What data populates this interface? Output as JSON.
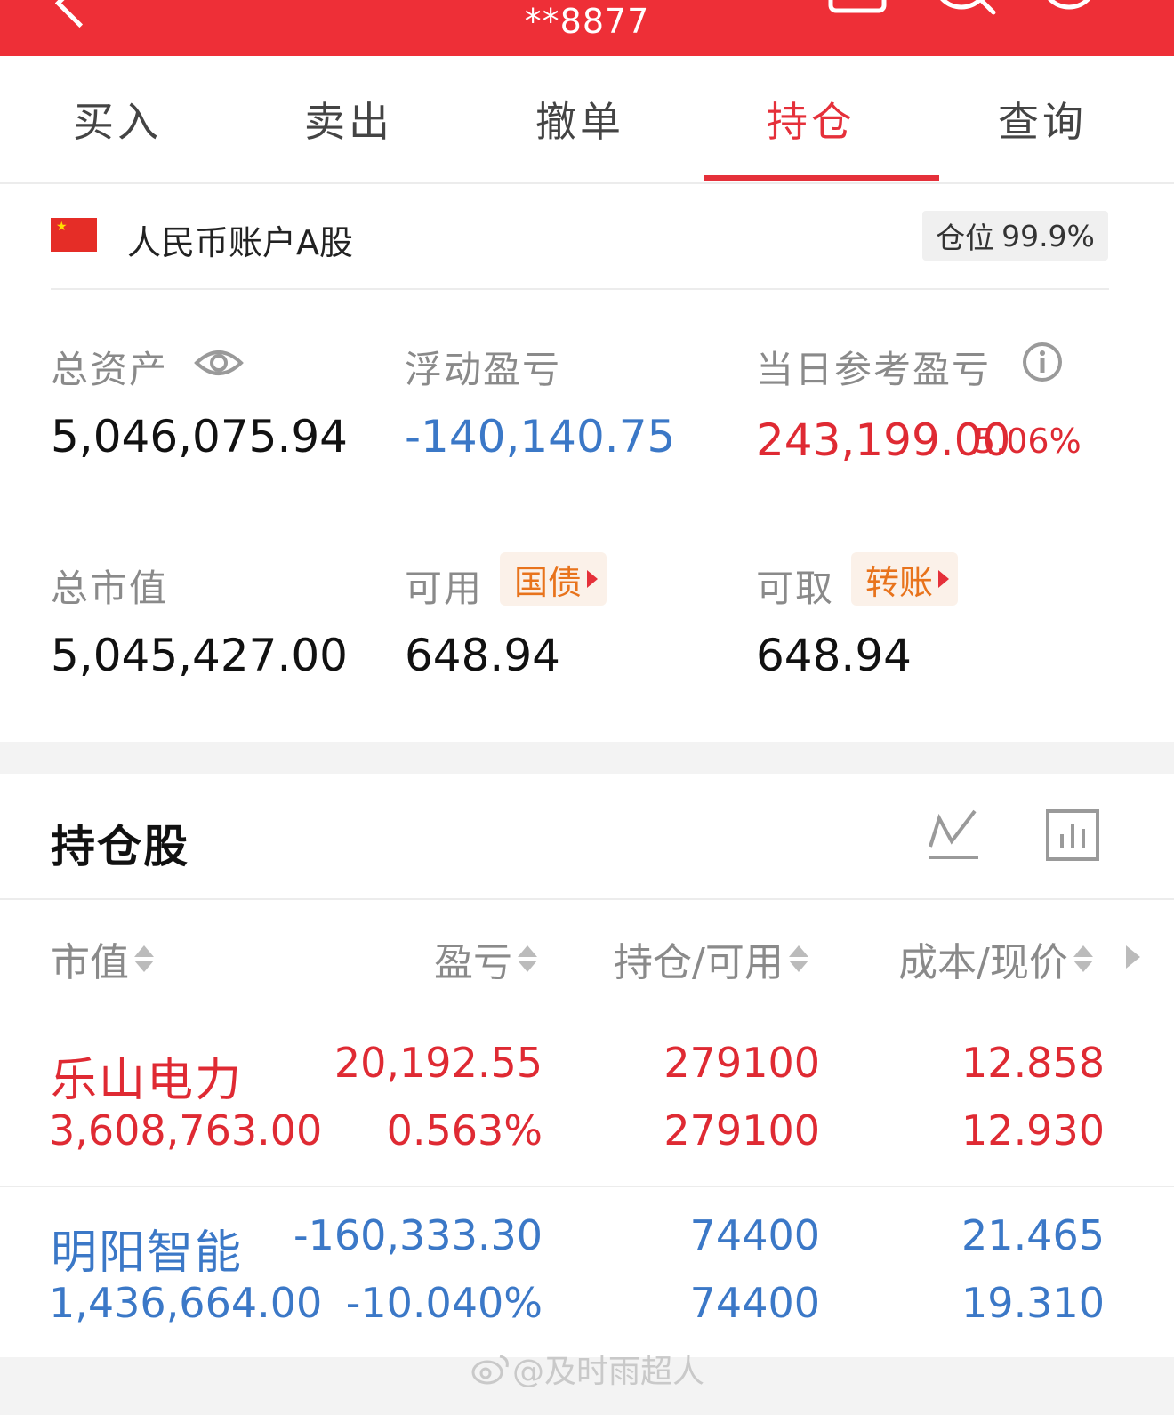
{
  "header": {
    "title": "**8877",
    "background_color": "#ee2f37",
    "icons": [
      "back-icon",
      "clipboard-icon",
      "search-icon",
      "service-icon"
    ]
  },
  "tabs": [
    {
      "label": "买入",
      "active": false
    },
    {
      "label": "卖出",
      "active": false
    },
    {
      "label": "撤单",
      "active": false
    },
    {
      "label": "持仓",
      "active": true
    },
    {
      "label": "查询",
      "active": false
    }
  ],
  "account": {
    "flag_icon": "china-flag-icon",
    "name": "人民币账户A股",
    "position_label": "仓位",
    "position_value": "99.9%"
  },
  "summary": {
    "total_assets_label": "总资产",
    "total_assets_value": "5,046,075.94",
    "floating_pl_label": "浮动盈亏",
    "floating_pl_value": "-140,140.75",
    "daily_pl_label": "当日参考盈亏",
    "daily_pl_value": "243,199.00",
    "daily_pl_pct": "5.06%",
    "market_value_label": "总市值",
    "market_value_value": "5,045,427.00",
    "available_label": "可用",
    "available_badge": "国债",
    "available_value": "648.94",
    "withdrawable_label": "可取",
    "withdrawable_badge": "转账",
    "withdrawable_value": "648.94"
  },
  "holdings": {
    "title": "持仓股",
    "columns": [
      "市值",
      "盈亏",
      "持仓/可用",
      "成本/现价"
    ],
    "rows": [
      {
        "name": "乐山电力",
        "market_value": "3,608,763.00",
        "pl": "20,192.55",
        "pl_pct": "0.563%",
        "position": "279100",
        "available": "279100",
        "cost": "12.858",
        "price": "12.930",
        "color": "#df2a33"
      },
      {
        "name": "明阳智能",
        "market_value": "1,436,664.00",
        "pl": "-160,333.30",
        "pl_pct": "-10.040%",
        "position": "74400",
        "available": "74400",
        "cost": "21.465",
        "price": "19.310",
        "color": "#3b78c7"
      }
    ]
  },
  "watermark": "@及时雨超人",
  "colors": {
    "accent_red": "#e5303a",
    "loss_blue": "#3b78c7",
    "badge_orange": "#e8731c"
  }
}
